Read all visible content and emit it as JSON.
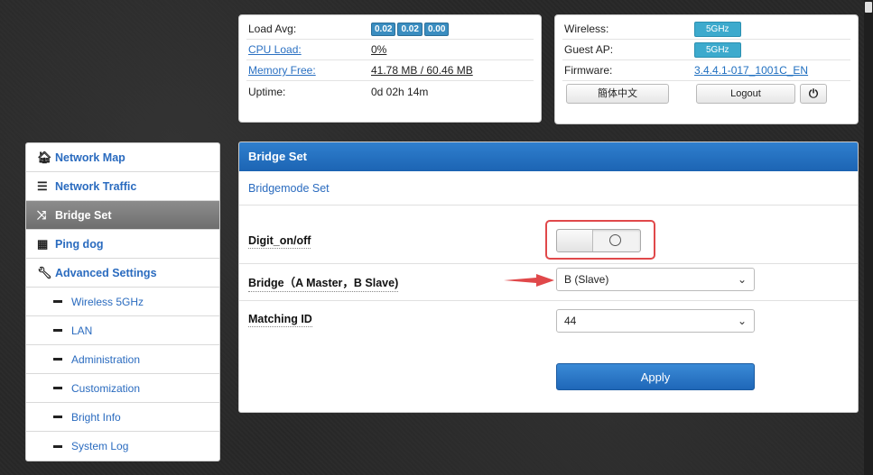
{
  "status": {
    "load_avg_label": "Load Avg:",
    "load_avg_values": [
      "0.02",
      "0.02",
      "0.00"
    ],
    "cpu_label": "CPU Load:",
    "cpu_value": "0%",
    "memory_label": "Memory Free:",
    "memory_value": "41.78 MB / 60.46 MB",
    "uptime_label": "Uptime:",
    "uptime_value": "0d 02h 14m",
    "wireless_label": "Wireless:",
    "wireless_value": "5GHz",
    "guest_label": "Guest AP:",
    "guest_value": "5GHz",
    "firmware_label": "Firmware:",
    "firmware_value": "3.4.4.1-017_1001C_EN",
    "lang_button": "簡体中文",
    "logout_button": "Logout",
    "power_icon": "⏻"
  },
  "sidebar": {
    "items": [
      {
        "label": "Network Map",
        "icon": "home-icon",
        "glyph": "🏠︎"
      },
      {
        "label": "Network Traffic",
        "icon": "list-icon",
        "glyph": "☰"
      },
      {
        "label": "Bridge Set",
        "icon": "shuffle-icon",
        "glyph": "⤨"
      },
      {
        "label": "Ping dog",
        "icon": "grid-icon",
        "glyph": "▦"
      },
      {
        "label": "Advanced Settings",
        "icon": "wrench-icon",
        "glyph": "🔧︎"
      }
    ],
    "subitems": [
      "Wireless 5GHz",
      "LAN",
      "Administration",
      "Customization",
      "Bright Info",
      "System Log"
    ]
  },
  "main": {
    "title": "Bridge Set",
    "subtitle": "Bridgemode Set",
    "digit_label": "Digit_on/off",
    "bridge_label": "Bridge（A Master，B Slave)",
    "bridge_value": "B (Slave)",
    "matching_label": "Matching ID",
    "matching_value": "44",
    "apply_label": "Apply",
    "chevron": "⌄"
  },
  "colors": {
    "accent": "#1f67b8",
    "highlight": "#e0484a"
  }
}
